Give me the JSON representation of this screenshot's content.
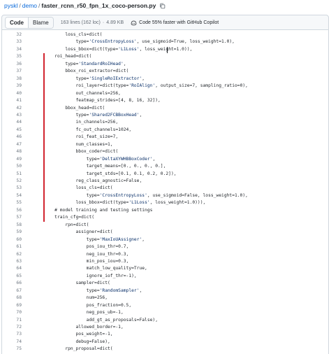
{
  "breadcrumb": {
    "owner": "pyskl",
    "separator": "/",
    "folder": "demo",
    "file": "faster_rcnn_r50_fpn_1x_coco-person.py"
  },
  "toolbar": {
    "code_tab": "Code",
    "blame_tab": "Blame",
    "lines_info": "163 lines (162 loc)",
    "dot": "·",
    "size_info": "4.89 KB",
    "copilot_text": "Code 55% faster with GitHub Copilot"
  },
  "code_lines": [
    {
      "n": "32",
      "t": "        loss_cls=dict("
    },
    {
      "n": "33",
      "t": "            type='CrossEntropyLoss', use_sigmoid=True, loss_weight=1.0),"
    },
    {
      "n": "34",
      "t": "        loss_bbox=dict(type='L1Loss', loss_weight=1.0)),"
    },
    {
      "n": "35",
      "t": "    roi_head=dict("
    },
    {
      "n": "36",
      "t": "        type='StandardRoIHead',"
    },
    {
      "n": "37",
      "t": "        bbox_roi_extractor=dict("
    },
    {
      "n": "38",
      "t": "            type='SingleRoIExtractor',"
    },
    {
      "n": "39",
      "t": "            roi_layer=dict(type='RoIAlign', output_size=7, sampling_ratio=0),"
    },
    {
      "n": "40",
      "t": "            out_channels=256,"
    },
    {
      "n": "41",
      "t": "            featmap_strides=[4, 8, 16, 32]),"
    },
    {
      "n": "42",
      "t": "        bbox_head=dict("
    },
    {
      "n": "43",
      "t": "            type='Shared2FCBBoxHead',"
    },
    {
      "n": "44",
      "t": "            in_channels=256,"
    },
    {
      "n": "45",
      "t": "            fc_out_channels=1024,"
    },
    {
      "n": "46",
      "t": "            roi_feat_size=7,"
    },
    {
      "n": "47",
      "t": "            num_classes=1,"
    },
    {
      "n": "48",
      "t": "            bbox_coder=dict("
    },
    {
      "n": "49",
      "t": "                type='DeltaXYWHBBoxCoder',"
    },
    {
      "n": "50",
      "t": "                target_means=[0., 0., 0., 0.],"
    },
    {
      "n": "51",
      "t": "                target_stds=[0.1, 0.1, 0.2, 0.2]),"
    },
    {
      "n": "52",
      "t": "            reg_class_agnostic=False,"
    },
    {
      "n": "53",
      "t": "            loss_cls=dict("
    },
    {
      "n": "54",
      "t": "                type='CrossEntropyLoss', use_sigmoid=False, loss_weight=1.0),"
    },
    {
      "n": "55",
      "t": "            loss_bbox=dict(type='L1Loss', loss_weight=1.0))),"
    },
    {
      "n": "56",
      "t": "    # model training and testing settings"
    },
    {
      "n": "57",
      "t": "    train_cfg=dict("
    },
    {
      "n": "58",
      "t": "        rpn=dict("
    },
    {
      "n": "59",
      "t": "            assigner=dict("
    },
    {
      "n": "60",
      "t": "                type='MaxIoUAssigner',"
    },
    {
      "n": "61",
      "t": "                pos_iou_thr=0.7,"
    },
    {
      "n": "62",
      "t": "                neg_iou_thr=0.3,"
    },
    {
      "n": "63",
      "t": "                min_pos_iou=0.3,"
    },
    {
      "n": "64",
      "t": "                match_low_quality=True,"
    },
    {
      "n": "65",
      "t": "                ignore_iof_thr=-1),"
    },
    {
      "n": "66",
      "t": "            sampler=dict("
    },
    {
      "n": "67",
      "t": "                type='RandomSampler',"
    },
    {
      "n": "68",
      "t": "                num=256,"
    },
    {
      "n": "69",
      "t": "                pos_fraction=0.5,"
    },
    {
      "n": "70",
      "t": "                neg_pos_ub=-1,"
    },
    {
      "n": "71",
      "t": "                add_gt_as_proposals=False),"
    },
    {
      "n": "72",
      "t": "            allowed_border=-1,"
    },
    {
      "n": "73",
      "t": "            pos_weight=-1,"
    },
    {
      "n": "74",
      "t": "            debug=False),"
    },
    {
      "n": "75",
      "t": "        rpn_proposal=dict("
    }
  ],
  "highlight": {
    "color": "#d1242f",
    "from_line": "35",
    "to_line": "57"
  },
  "colors": {
    "link": "#0969da",
    "string": "#0a3069",
    "line_number": "#6e7781",
    "border": "#d0d7de"
  }
}
